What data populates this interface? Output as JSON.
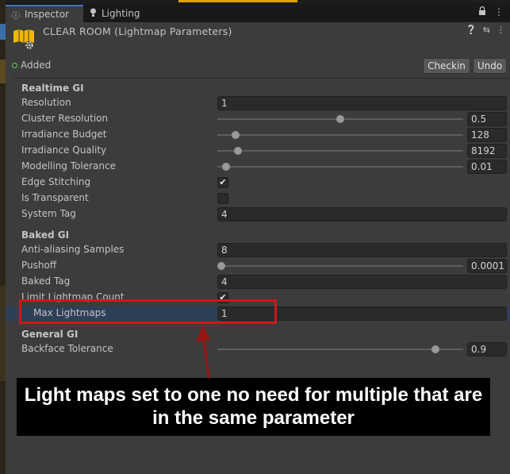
{
  "tabs": [
    {
      "label": "Inspector",
      "icon": "info-icon",
      "active": true
    },
    {
      "label": "Lighting",
      "icon": "bulb-icon",
      "active": false
    }
  ],
  "header": {
    "title": "CLEAR ROOM (Lightmap Parameters)"
  },
  "status": {
    "label": "Added",
    "checkin_label": "Checkin",
    "undo_label": "Undo"
  },
  "realtime_gi": {
    "title": "Realtime GI",
    "resolution": {
      "label": "Resolution",
      "value": "1"
    },
    "cluster_resolution": {
      "label": "Cluster Resolution",
      "value": "0.5",
      "level": 0.5
    },
    "irradiance_budget": {
      "label": "Irradiance Budget",
      "value": "128",
      "level": 0.06
    },
    "irradiance_quality": {
      "label": "Irradiance Quality",
      "value": "8192",
      "level": 0.07
    },
    "modelling_tolerance": {
      "label": "Modelling Tolerance",
      "value": "0.01",
      "level": 0.02
    },
    "edge_stitching": {
      "label": "Edge Stitching",
      "checked": true
    },
    "is_transparent": {
      "label": "Is Transparent",
      "checked": false
    },
    "system_tag": {
      "label": "System Tag",
      "value": "4"
    }
  },
  "baked_gi": {
    "title": "Baked GI",
    "anti_aliasing_samples": {
      "label": "Anti-aliasing Samples",
      "value": "8"
    },
    "pushoff": {
      "label": "Pushoff",
      "value": "0.0001",
      "level": 0.0
    },
    "baked_tag": {
      "label": "Baked Tag",
      "value": "4"
    },
    "limit_lightmap_count": {
      "label": "Limit Lightmap Count",
      "checked": true
    },
    "max_lightmaps": {
      "label": "Max Lightmaps",
      "value": "1"
    }
  },
  "general_gi": {
    "title": "General GI",
    "backface_tolerance": {
      "label": "Backface Tolerance",
      "value": "0.9",
      "level": 0.9
    }
  },
  "annotation": {
    "text": "Light maps set to one no need for multiple that are in the same parameter"
  },
  "colors": {
    "accent": "#3a79bb",
    "callout": "#cc1818",
    "added": "#5cc75c"
  }
}
